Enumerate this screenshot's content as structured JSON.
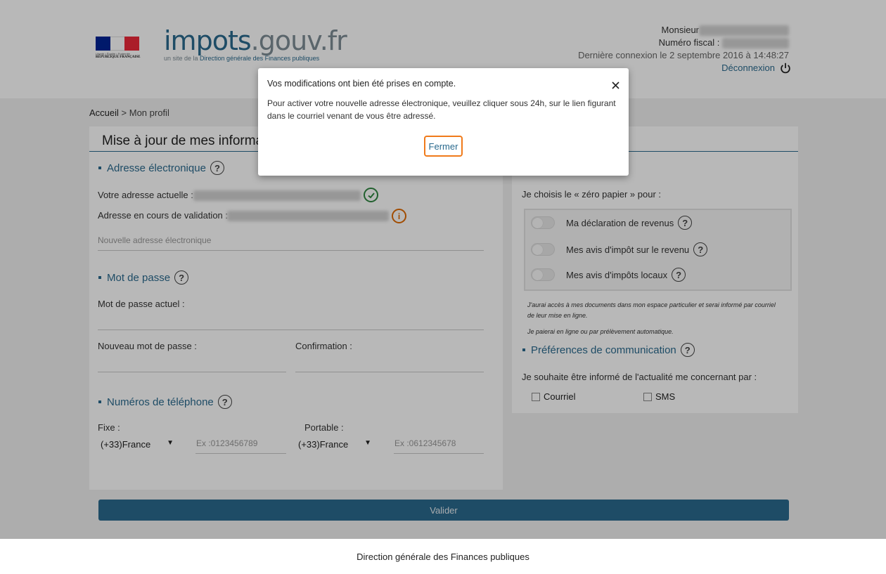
{
  "header": {
    "flag_motto": "Liberté • Égalité • Fraternité",
    "flag_republic": "RÉPUBLIQUE FRANÇAISE",
    "logo_part1": "impots",
    "logo_part2": ".gouv.fr",
    "logo_sub_prefix": "un site de la ",
    "logo_sub_highlight": "Direction générale des Finances publiques",
    "user_label": "Monsieur",
    "fiscal_label": "Numéro fiscal :",
    "last_login": "Dernière connexion le 2 septembre 2016 à 14:48:27",
    "logout_label": "Déconnexion"
  },
  "breadcrumb": {
    "home": "Accueil",
    "separator": " > ",
    "current": "Mon profil"
  },
  "left_panel": {
    "title": "Mise à jour de mes informations",
    "email_section": {
      "title": "Adresse électronique",
      "current_label": "Votre adresse actuelle :",
      "pending_label": "Adresse en cours de validation :",
      "new_placeholder": "Nouvelle adresse électronique"
    },
    "password_section": {
      "title": "Mot de passe",
      "current_label": "Mot de passe actuel :",
      "new_label": "Nouveau mot de passe :",
      "confirm_label": "Confirmation :"
    },
    "phone_section": {
      "title": "Numéros de téléphone",
      "fixe_label": "Fixe :",
      "fixe_country": "(+33)France",
      "fixe_placeholder": "Ex :0123456789",
      "portable_label": "Portable :",
      "portable_country": "(+33)France",
      "portable_placeholder": "Ex :0612345678"
    }
  },
  "right_panel": {
    "zero_paper_label": "Je choisis le « zéro papier » pour :",
    "toggles": [
      {
        "label": "Ma déclaration de revenus"
      },
      {
        "label": "Mes avis d'impôt sur le revenu"
      },
      {
        "label": "Mes avis d'impôts locaux"
      }
    ],
    "note1": "J'aurai accès à mes documents dans mon espace particulier et serai informé par courriel de leur mise en ligne.",
    "note2": "Je paierai en ligne ou par prélèvement automatique.",
    "prefs_title": "Préférences de communication",
    "prefs_label": "Je souhaite être informé de l'actualité me concernant par :",
    "option_mail": "Courriel",
    "option_sms": "SMS"
  },
  "validate_label": "Valider",
  "footer_text": "Direction générale des Finances publiques",
  "modal": {
    "title": "Vos modifications ont bien été prises en compte.",
    "body": "Pour activer votre nouvelle adresse électronique, veuillez cliquer sous 24h, sur le lien figurant dans le courriel venant de vous être adressé.",
    "close_button": "Fermer"
  },
  "colors": {
    "primary": "#2a6a8e",
    "accent_orange": "#f07a1a",
    "success_green": "#2e8540"
  },
  "icons": [
    "power-icon",
    "help-icon",
    "check-circle-icon",
    "info-icon",
    "close-icon",
    "chevron-down-icon"
  ]
}
